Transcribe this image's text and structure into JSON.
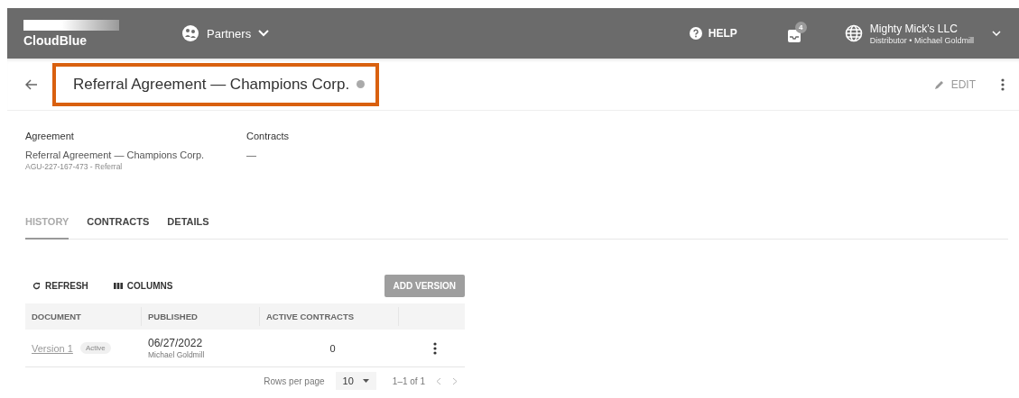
{
  "header": {
    "logo": "CloudBlue",
    "module": "Partners",
    "help": "HELP",
    "notifications": "4",
    "account": {
      "name": "Mighty Mick's LLC",
      "role": "Distributor • Michael Goldmill"
    }
  },
  "title_bar": {
    "title": "Referral Agreement — Champions Corp.",
    "highlighted": true,
    "edit": "EDIT"
  },
  "info": [
    {
      "label": "Agreement",
      "value": "Referral Agreement — Champions Corp.",
      "sub": "AGU-227-167-473 - Referral"
    },
    {
      "label": "Contracts",
      "value": "—"
    }
  ],
  "tabs": [
    {
      "label": "HISTORY",
      "selected": true
    },
    {
      "label": "CONTRACTS",
      "selected": false
    },
    {
      "label": "DETAILS",
      "selected": false
    }
  ],
  "toolbar": {
    "refresh": "REFRESH",
    "columns": "COLUMNS",
    "add": "ADD VERSION"
  },
  "table": {
    "columns": [
      "DOCUMENT",
      "PUBLISHED",
      "ACTIVE CONTRACTS"
    ],
    "rows": [
      {
        "document": "Version 1",
        "status": "Active",
        "date": "06/27/2022",
        "author": "Michael Goldmill",
        "active_contracts": "0"
      }
    ]
  },
  "pagination": {
    "label": "Rows per page",
    "per_page": "10",
    "range": "1–1 of 1"
  }
}
